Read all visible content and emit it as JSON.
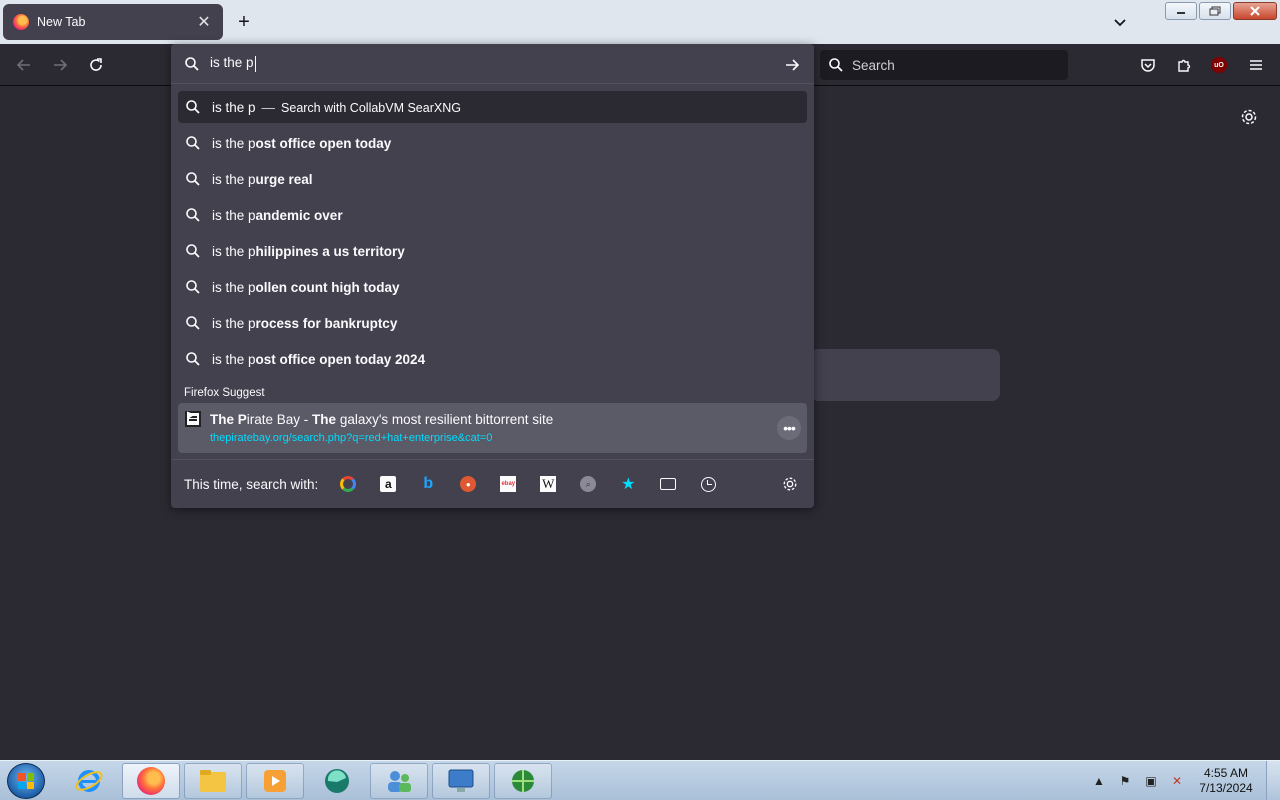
{
  "tab": {
    "title": "New Tab",
    "close": "✕"
  },
  "newtab": "+",
  "search_box": {
    "label": "Search"
  },
  "ublock_badge": "uO",
  "urlbar": {
    "typed_value": "is the p",
    "heuristic": {
      "text": "is the p",
      "separator": "—",
      "action": "Search with CollabVM SearXNG"
    },
    "suggestions": [
      {
        "prefix": "is the p",
        "completion": "ost office open today"
      },
      {
        "prefix": "is the p",
        "completion": "urge real"
      },
      {
        "prefix": "is the p",
        "completion": "andemic over"
      },
      {
        "prefix": "is the p",
        "completion": "hilippines a us territory"
      },
      {
        "prefix": "is the p",
        "completion": "ollen count high today"
      },
      {
        "prefix": "is the p",
        "completion": "rocess for bankruptcy"
      },
      {
        "prefix": "is the p",
        "completion": "ost office open today 2024"
      }
    ],
    "group_label": "Firefox Suggest",
    "firefox_suggest": {
      "title_bold1": "The P",
      "title_part1": "irate Bay - ",
      "title_bold2": "The",
      "title_part2": " galaxy's most resilient bittorrent site",
      "url": "thepiratebay.org/search.php?q=red+hat+enterprise&cat=0",
      "menu": "•••"
    },
    "one_offs_label": "This time, search with:",
    "engines": [
      "google",
      "amazon",
      "bing",
      "duckduckgo",
      "ebay",
      "wikipedia",
      "searxng",
      "bookmarks",
      "tabs",
      "history"
    ],
    "engine_glyphs": {
      "amazon": "a",
      "bing": "b",
      "wikipedia": "W",
      "ebay": "ebay",
      "star": "★"
    }
  },
  "taskbar": {
    "apps": [
      "internet-explorer",
      "firefox",
      "file-explorer",
      "media-player",
      "browser-app",
      "users-app",
      "remote-desktop",
      "network-app"
    ],
    "clock": {
      "time": "4:55 AM",
      "date": "7/13/2024"
    }
  },
  "colors": {
    "accent": "#00ddff",
    "panel": "#42414d",
    "toolbar": "#2b2a33"
  }
}
